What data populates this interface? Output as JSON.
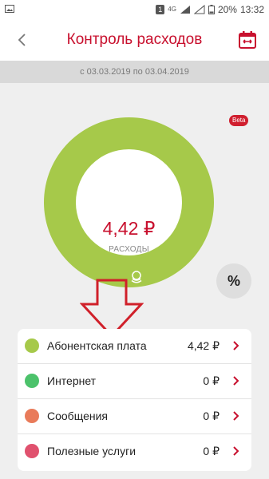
{
  "status": {
    "network": "4G",
    "sim": "1",
    "battery": "20%",
    "time": "13:32"
  },
  "header": {
    "title": "Контроль расходов",
    "back_icon": "chevron-left-icon",
    "calendar_icon": "calendar-icon"
  },
  "period": {
    "text": "с 03.03.2019 по 03.04.2019"
  },
  "badge": {
    "text": "Beta"
  },
  "summary": {
    "amount": "4,42 ₽",
    "label": "РАСХОДЫ"
  },
  "percent_button": {
    "label": "%"
  },
  "colors": {
    "accent": "#c8102e",
    "donut": "#a6c94a"
  },
  "categories": [
    {
      "label": "Абонентская плата",
      "value": "4,42 ₽",
      "color": "#a6c94a"
    },
    {
      "label": "Интернет",
      "value": "0 ₽",
      "color": "#4cc26b"
    },
    {
      "label": "Сообщения",
      "value": "0 ₽",
      "color": "#e97b5a"
    },
    {
      "label": "Полезные услуги",
      "value": "0 ₽",
      "color": "#e0516e"
    }
  ]
}
